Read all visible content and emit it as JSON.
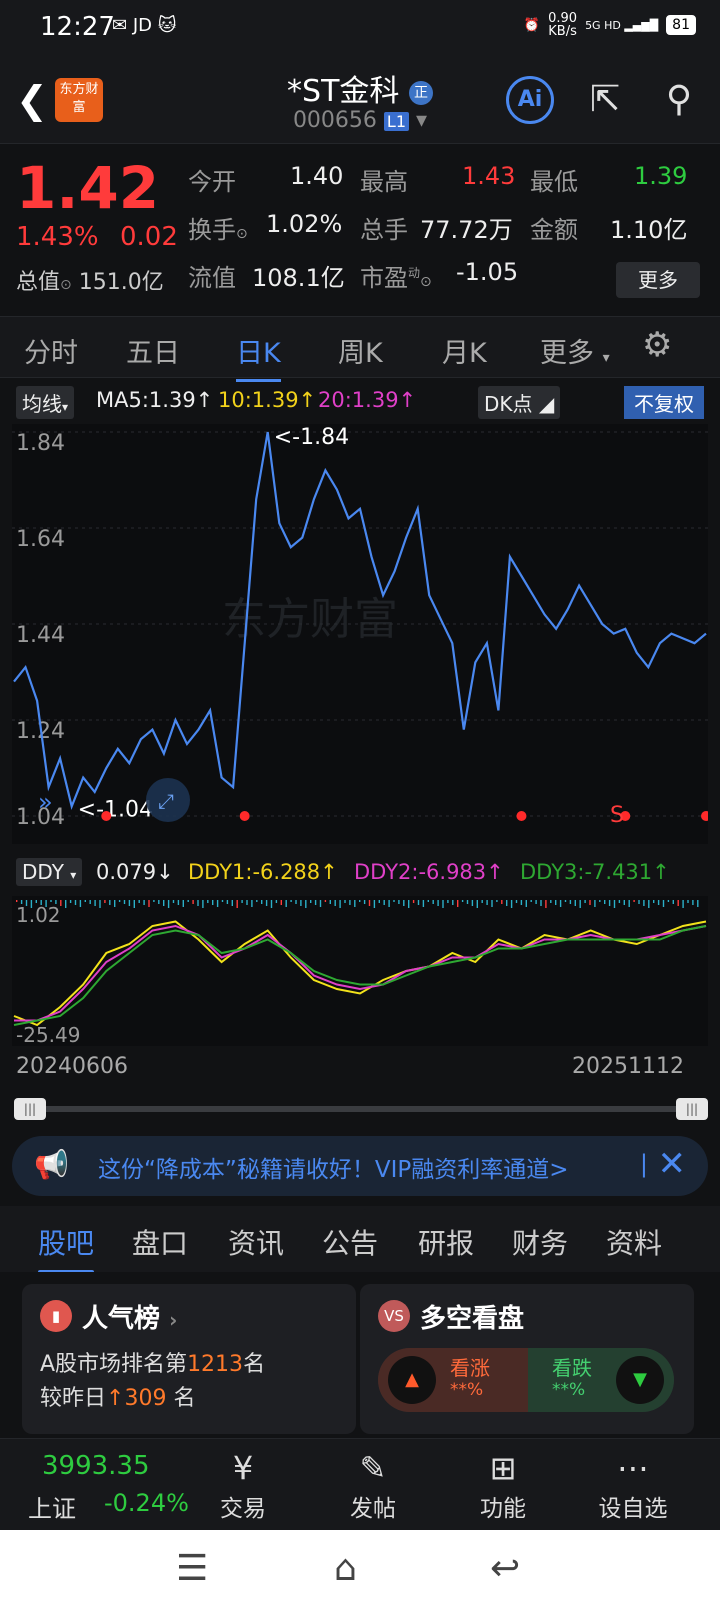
{
  "status_bar": {
    "time": "12:27",
    "apps": "JD",
    "net_speed": "0.90",
    "net_unit": "KB/s",
    "signal": "5G HD",
    "battery": "81"
  },
  "header": {
    "logo_text": "东方财富",
    "stock_name": "*ST金科",
    "badge": "正",
    "stock_code": "000656",
    "level": "L1",
    "ai_label": "Ai"
  },
  "quote": {
    "price": "1.42",
    "pct_change": "1.43%",
    "change": "0.02",
    "total_cap_label": "总值",
    "total_cap": "151.0亿",
    "open_label": "今开",
    "open": "1.40",
    "high_label": "最高",
    "high": "1.43",
    "low_label": "最低",
    "low": "1.39",
    "turnover_label": "换手",
    "turnover": "1.02%",
    "volume_label": "总手",
    "volume": "77.72万",
    "amount_label": "金额",
    "amount": "1.10亿",
    "float_cap_label": "流值",
    "float_cap": "108.1亿",
    "pe_label": "市盈",
    "pe_sup": "动",
    "pe": "-1.05",
    "more_label": "更多"
  },
  "kline_tabs": [
    "分时",
    "五日",
    "日K",
    "周K",
    "月K",
    "更多"
  ],
  "kline_active": 2,
  "ma_bar": {
    "indicator": "均线",
    "ma5": "MA5:1.39↑",
    "ma10": "10:1.39↑",
    "ma20": "20:1.39↑",
    "dk": "DK点",
    "fuquan": "不复权"
  },
  "ddy_bar": {
    "indicator": "DDY",
    "ddy": "0.079↓",
    "ddy1": "DDY1:-6.288↑",
    "ddy2": "DDY2:-6.983↑",
    "ddy3": "DDY3:-7.431↑"
  },
  "chart_data": [
    {
      "type": "line",
      "title": "",
      "yticks": [
        "1.84",
        "1.64",
        "1.44",
        "1.24",
        "1.04"
      ],
      "ylim": [
        1.04,
        1.84
      ],
      "max_label": "<-1.84",
      "min_label": "<-1.04",
      "signal_label": "S",
      "watermark": "东方财富",
      "series": [
        {
          "values": [
            1.32,
            1.35,
            1.28,
            1.1,
            1.16,
            1.06,
            1.12,
            1.09,
            1.14,
            1.18,
            1.15,
            1.2,
            1.22,
            1.17,
            1.24,
            1.19,
            1.22,
            1.26,
            1.12,
            1.1,
            1.4,
            1.7,
            1.84,
            1.65,
            1.6,
            1.62,
            1.7,
            1.76,
            1.72,
            1.66,
            1.68,
            1.58,
            1.5,
            1.55,
            1.62,
            1.68,
            1.5,
            1.45,
            1.4,
            1.22,
            1.36,
            1.4,
            1.26,
            1.58,
            1.54,
            1.5,
            1.46,
            1.43,
            1.47,
            1.52,
            1.48,
            1.44,
            1.42,
            1.43,
            1.38,
            1.35,
            1.4,
            1.42,
            1.41,
            1.4,
            1.42
          ]
        }
      ]
    },
    {
      "type": "line",
      "title": "",
      "yticks": [
        "1.02",
        "-25.49"
      ],
      "x_start": "20240606",
      "x_end": "20251112",
      "series": [
        {
          "values": [
            -22,
            -24,
            -20,
            -15,
            -8,
            -6,
            -2,
            -1,
            -5,
            -10,
            -6,
            -3,
            -9,
            -14,
            -16,
            -17,
            -14,
            -12,
            -11,
            -8,
            -10,
            -5,
            -7,
            -4,
            -5,
            -3,
            -5,
            -6,
            -4,
            -2,
            -1
          ]
        },
        {
          "values": [
            -23,
            -23,
            -21,
            -16,
            -10,
            -7,
            -3,
            -2,
            -4,
            -9,
            -7,
            -4,
            -8,
            -13,
            -15,
            -16,
            -15,
            -12,
            -11,
            -9,
            -9,
            -6,
            -7,
            -5,
            -5,
            -4,
            -5,
            -5,
            -4,
            -3,
            -2
          ]
        },
        {
          "values": [
            -24,
            -23,
            -22,
            -18,
            -12,
            -8,
            -4,
            -3,
            -4,
            -8,
            -7,
            -5,
            -8,
            -12,
            -14,
            -15,
            -15,
            -13,
            -11,
            -10,
            -9,
            -7,
            -7,
            -6,
            -5,
            -5,
            -5,
            -5,
            -5,
            -3,
            -2
          ]
        }
      ]
    }
  ],
  "date_start": "20240606",
  "date_end": "20251112",
  "ad": {
    "text": "这份“降成本”秘籍请收好！VIP融资利率通道>"
  },
  "bottom_tabs": [
    "股吧",
    "盘口",
    "资讯",
    "公告",
    "研报",
    "财务",
    "资料"
  ],
  "bottom_active": 0,
  "cards": {
    "popularity": {
      "title": "人气榜",
      "line1_a": "A股市场排名第",
      "rank": "1213",
      "line1_b": "名",
      "line2_a": "较昨日",
      "delta": "309",
      "line2_b": "名"
    },
    "longshort": {
      "title": "多空看盘",
      "up": "看涨",
      "down": "看跌",
      "up_pct": "**%",
      "down_pct": "**%"
    }
  },
  "bottom_nav": {
    "index_value": "3993.35",
    "index_name": "上证",
    "index_change": "-0.24%",
    "items": [
      "交易",
      "发帖",
      "功能",
      "设自选"
    ]
  },
  "colors": {
    "up": "#ff3b3b",
    "down": "#2ecc40",
    "accent": "#4a88f0"
  }
}
